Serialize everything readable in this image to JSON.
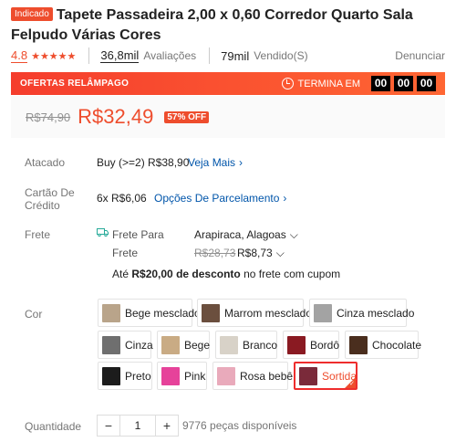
{
  "header": {
    "badge": "Indicado",
    "title": "Tapete Passadeira 2,00 x 0,60 Corredor Quarto Sala Felpudo Várias Cores"
  },
  "meta": {
    "rating": "4.8",
    "stars": "★★★★★",
    "reviews_count": "36,8mil",
    "reviews_label": "Avaliações",
    "sold_count": "79mil",
    "sold_label": "Vendido(S)",
    "report_label": "Denunciar"
  },
  "flash": {
    "label": "OFERTAS RELÂMPAGO",
    "ends_label": "TERMINA EM",
    "hours": "00",
    "minutes": "00",
    "seconds": "00"
  },
  "price": {
    "old": "R$74,90",
    "current": "R$32,49",
    "discount": "57% OFF"
  },
  "wholesale": {
    "label": "Atacado",
    "text": "Buy (>=2) R$38,90",
    "link": "Veja Mais"
  },
  "installments": {
    "label": "Cartão De Crédito",
    "text": "6x R$6,06",
    "link": "Opções De Parcelamento"
  },
  "shipping": {
    "label": "Frete",
    "to_label": "Frete Para",
    "location": "Arapiraca, Alagoas",
    "fee_label": "Frete",
    "fee_old": "R$28,73",
    "fee_new": "R$8,73",
    "promo_prefix": "Até ",
    "promo_bold": "R$20,00 de desconto",
    "promo_suffix": " no frete com cupom"
  },
  "colors": {
    "label": "Cor",
    "options": [
      {
        "label": "Bege mesclado",
        "swatch": "#b9a48a"
      },
      {
        "label": "Marrom mesclado",
        "swatch": "#6b4f3e"
      },
      {
        "label": "Cinza mesclado",
        "swatch": "#a3a3a3"
      },
      {
        "label": "Cinza",
        "swatch": "#6f6f6f"
      },
      {
        "label": "Bege",
        "swatch": "#c9ab84"
      },
      {
        "label": "Branco",
        "swatch": "#d8d2c8"
      },
      {
        "label": "Bordô",
        "swatch": "#8a1a22"
      },
      {
        "label": "Chocolate",
        "swatch": "#4a2e1e"
      },
      {
        "label": "Preto",
        "swatch": "#1c1c1c"
      },
      {
        "label": "Pink",
        "swatch": "#e6429a"
      },
      {
        "label": "Rosa bebê",
        "swatch": "#e9aabb"
      },
      {
        "label": "Sortida",
        "swatch": "#7a2a3a"
      }
    ],
    "selected": "Sortida"
  },
  "quantity": {
    "label": "Quantidade",
    "minus": "−",
    "value": "1",
    "plus": "+",
    "stock": "9776 peças disponíveis"
  },
  "accent_color": "#ee4d2d"
}
